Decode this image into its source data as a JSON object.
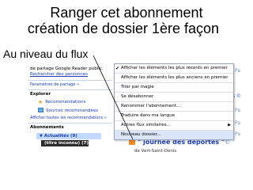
{
  "slide": {
    "title_line1": "Ranger cet abonnement",
    "title_line2": "création de dossier 1ère façon",
    "subtitle": "Au niveau du flux"
  },
  "left_pane": {
    "share_text": "de partage Google Reader public.",
    "search_people": "Rechercher des personnes",
    "share_settings": "Paramètres de partage »",
    "explore_heading": "Explorer",
    "explore_items": [
      {
        "icon": "star-icon",
        "label": "Recommandations"
      },
      {
        "icon": "feed-icon",
        "label": "Sources recommandées"
      }
    ],
    "show_all": "Afficher toutes les recommandations »",
    "subscriptions_heading": "Abonnements",
    "subscriptions": [
      {
        "label": "Actualités (9)",
        "state": "selected"
      },
      {
        "label": "(titre inconnu) (7)",
        "state": "dark"
      }
    ]
  },
  "context_menu": {
    "items": [
      {
        "label": "Afficher les éléments les plus récents en premier",
        "checked": true
      },
      {
        "label": "Afficher les éléments les plus anciens en premier",
        "checked": false
      },
      {
        "label": "Trier par magie",
        "checked": false
      },
      {
        "label": "Se désabonner",
        "checked": false
      },
      {
        "label": "Renommer l'abonnement...",
        "checked": false
      },
      {
        "label": "Traduire dans ma langue",
        "checked": false
      },
      {
        "label": "Autres flux similaires...",
        "checked": false,
        "submenu": true
      },
      {
        "label": "Nouveau dossier...",
        "checked": false,
        "highlight": true
      }
    ]
  },
  "feed": {
    "title": "\" journée des déportés \"",
    "title_badge": "©",
    "subtitle": "de Vert-Saint-Denis",
    "partials": [
      "Pa",
      "s ©",
      "Pa",
      "Pa",
      "Pa"
    ]
  },
  "colors": {
    "link": "#1a3fb8",
    "selected_bg": "#c3d9ff",
    "dark_bg": "#2a2a2a",
    "menu_border": "#9aa7bd"
  }
}
